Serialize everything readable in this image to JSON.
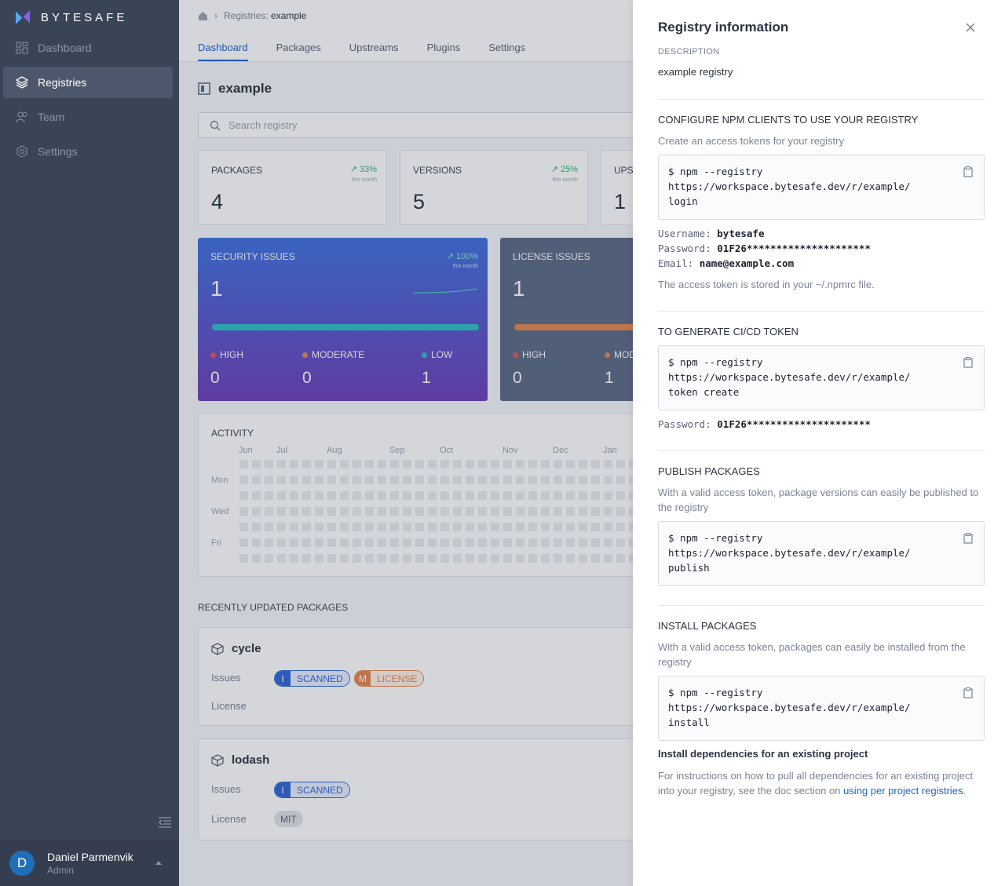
{
  "brand": {
    "name": "BYTESAFE",
    "accent": "#1f63c9"
  },
  "sidebar": {
    "items": [
      {
        "label": "Dashboard",
        "icon": "dashboard-icon"
      },
      {
        "label": "Registries",
        "icon": "layers-icon",
        "active": true
      },
      {
        "label": "Team",
        "icon": "team-icon"
      },
      {
        "label": "Settings",
        "icon": "gear-icon"
      }
    ],
    "user": {
      "initial": "D",
      "name": "Daniel Parmenvik",
      "role": "Admin"
    }
  },
  "breadcrumb": {
    "prefix": "Registries:",
    "current": "example"
  },
  "tabs": [
    "Dashboard",
    "Packages",
    "Upstreams",
    "Plugins",
    "Settings"
  ],
  "registry": {
    "name": "example"
  },
  "search": {
    "placeholder": "Search registry"
  },
  "stats": [
    {
      "label": "PACKAGES",
      "value": "4",
      "trend": "33%",
      "sub": "this month"
    },
    {
      "label": "VERSIONS",
      "value": "5",
      "trend": "25%",
      "sub": "this month"
    },
    {
      "label": "UPST",
      "value": "1"
    }
  ],
  "security": {
    "title": "SECURITY ISSUES",
    "value": "1",
    "trend": "100%",
    "sub": "this month",
    "levels": [
      {
        "label": "HIGH",
        "value": "0",
        "color": "#e5564f"
      },
      {
        "label": "MODERATE",
        "value": "0",
        "color": "#e5864f"
      },
      {
        "label": "LOW",
        "value": "1",
        "color": "#2ec0c7"
      }
    ]
  },
  "license": {
    "title": "LICENSE ISSUES",
    "value": "1",
    "levels": [
      {
        "label": "HIGH",
        "value": "0",
        "color": "#e5564f"
      },
      {
        "label": "MOD",
        "value": "1",
        "color": "#e5864f"
      }
    ]
  },
  "activity": {
    "label": "ACTIVITY",
    "months": [
      "Jun",
      "Jul",
      "Aug",
      "Sep",
      "Oct",
      "Nov",
      "Dec",
      "Jan"
    ],
    "days": [
      "Mon",
      "Wed",
      "Fri"
    ]
  },
  "recent": {
    "title": "RECENTLY UPDATED PACKAGES",
    "issues_label": "Issues",
    "license_label": "License",
    "packages": [
      {
        "name": "cycle"
      },
      {
        "name": "lodash",
        "license": "MIT"
      }
    ],
    "badge_scanned": {
      "letter": "I",
      "text": "SCANNED"
    },
    "badge_license": {
      "letter": "M",
      "text": "LICENSE"
    }
  },
  "drawer": {
    "title": "Registry information",
    "description_caption": "DESCRIPTION",
    "description": "example registry",
    "configure": {
      "heading": "CONFIGURE NPM CLIENTS TO USE YOUR REGISTRY",
      "sub": "Create an access tokens for your registry",
      "code": "$ npm --registry\nhttps://workspace.bytesafe.dev/r/example/\nlogin",
      "username_label": "Username:",
      "username": "bytesafe",
      "password_label": "Password:",
      "password": "01F26*********************",
      "email_label": "Email:",
      "email": "name@example.com",
      "note": "The access token is stored in your ~/.npmrc file."
    },
    "cicd": {
      "heading": "TO GENERATE CI/CD TOKEN",
      "code": "$ npm --registry\nhttps://workspace.bytesafe.dev/r/example/\ntoken create",
      "password_label": "Password:",
      "password": "01F26*********************"
    },
    "publish": {
      "heading": "PUBLISH PACKAGES",
      "sub": "With a valid access token, package versions can easily be published to the registry",
      "code": "$ npm --registry\nhttps://workspace.bytesafe.dev/r/example/\npublish"
    },
    "install": {
      "heading": "INSTALL PACKAGES",
      "sub": "With a valid access token, packages can easily be installed from the registry",
      "code": "$ npm --registry\nhttps://workspace.bytesafe.dev/r/example/\ninstall",
      "existing_title": "Install dependencies for an existing project",
      "existing_text": "For instructions on how to pull all dependencies for an existing project into your registry, see the doc section on",
      "existing_link": "using per project registries",
      "existing_end": "."
    }
  }
}
